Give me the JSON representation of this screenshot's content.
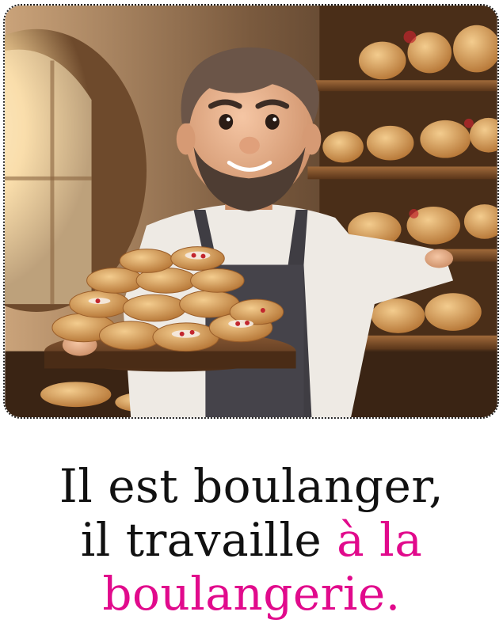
{
  "caption": {
    "line1": "Il est boulanger,",
    "line2_prefix": "il travaille ",
    "line2_highlight": "à la",
    "line3_highlight": "boulangerie."
  },
  "colors": {
    "highlight": "#e10a8c",
    "text": "#111111"
  },
  "illustration": {
    "subject": "baker-with-tray-of-pastries-in-bakery"
  }
}
